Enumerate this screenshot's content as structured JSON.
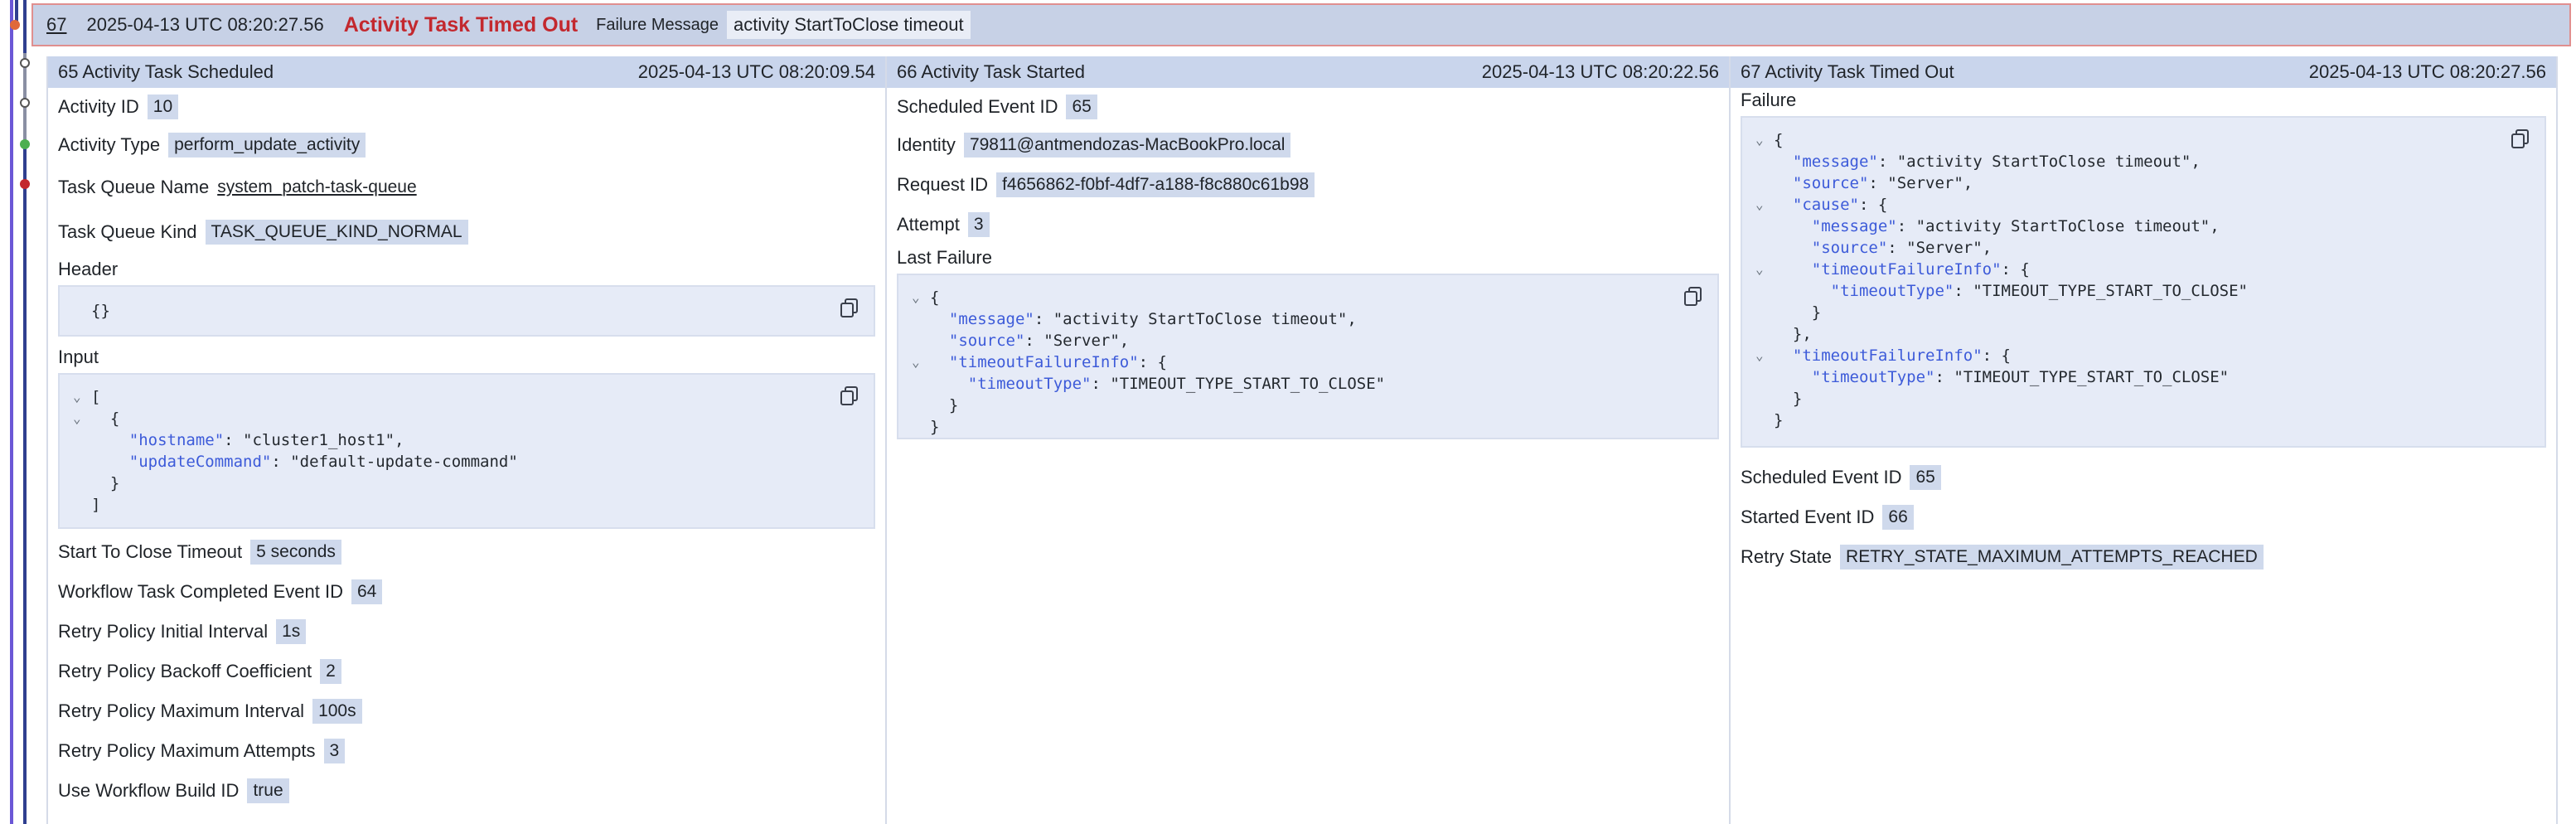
{
  "event": {
    "id": "67",
    "timestamp": "2025-04-13 UTC 08:20:27.56",
    "title": "Activity Task Timed Out",
    "failure_message_label": "Failure Message",
    "failure_message_value": "activity StartToClose timeout"
  },
  "col1": {
    "header_title": "65 Activity Task Scheduled",
    "header_time": "2025-04-13 UTC 08:20:09.54",
    "activity_id_label": "Activity ID",
    "activity_id": "10",
    "activity_type_label": "Activity Type",
    "activity_type": "perform_update_activity",
    "task_queue_name_label": "Task Queue Name",
    "task_queue_name": "system_patch-task-queue",
    "task_queue_kind_label": "Task Queue Kind",
    "task_queue_kind": "TASK_QUEUE_KIND_NORMAL",
    "header_label": "Header",
    "header_json": "{}",
    "input_label": "Input",
    "input_json": {
      "line1": "[",
      "line2": "  {",
      "k_hostname": "\"hostname\"",
      "v_hostname": ": \"cluster1_host1\",",
      "k_update": "\"updateCommand\"",
      "v_update": ": \"default-update-command\"",
      "line5": "  }",
      "line6": "]"
    },
    "start_to_close_label": "Start To Close Timeout",
    "start_to_close": "5 seconds",
    "wf_task_completed_label": "Workflow Task Completed Event ID",
    "wf_task_completed": "64",
    "retry_initial_label": "Retry Policy Initial Interval",
    "retry_initial": "1s",
    "retry_backoff_label": "Retry Policy Backoff Coefficient",
    "retry_backoff": "2",
    "retry_max_interval_label": "Retry Policy Maximum Interval",
    "retry_max_interval": "100s",
    "retry_max_attempts_label": "Retry Policy Maximum Attempts",
    "retry_max_attempts": "3",
    "use_build_id_label": "Use Workflow Build ID",
    "use_build_id": "true"
  },
  "col2": {
    "header_title": "66 Activity Task Started",
    "header_time": "2025-04-13 UTC 08:20:22.56",
    "scheduled_event_id_label": "Scheduled Event ID",
    "scheduled_event_id": "65",
    "identity_label": "Identity",
    "identity": "79811@antmendozas-MacBookPro.local",
    "request_id_label": "Request ID",
    "request_id": "f4656862-f0bf-4df7-a188-f8c880c61b98",
    "attempt_label": "Attempt",
    "attempt": "3",
    "last_failure_label": "Last Failure",
    "json": {
      "open": "{",
      "k_message": "\"message\"",
      "v_message": ": \"activity StartToClose timeout\",",
      "k_source": "\"source\"",
      "v_source": ": \"Server\",",
      "k_tfi": "\"timeoutFailureInfo\"",
      "v_tfi": ": {",
      "k_ttype": "\"timeoutType\"",
      "v_ttype": ": \"TIMEOUT_TYPE_START_TO_CLOSE\"",
      "close_inner": "}",
      "close": "}"
    }
  },
  "col3": {
    "header_title": "67 Activity Task Timed Out",
    "header_time": "2025-04-13 UTC 08:20:27.56",
    "failure_label": "Failure",
    "json": {
      "open": "{",
      "k_message": "\"message\"",
      "v_message": ": \"activity StartToClose timeout\",",
      "k_source": "\"source\"",
      "v_source": ": \"Server\",",
      "k_cause": "\"cause\"",
      "v_cause": ": {",
      "k_message2": "\"message\"",
      "v_message2": ": \"activity StartToClose timeout\",",
      "k_source2": "\"source\"",
      "v_source2": ": \"Server\",",
      "k_tfi2": "\"timeoutFailureInfo\"",
      "v_tfi2": ": {",
      "k_ttype2": "\"timeoutType\"",
      "v_ttype2": ": \"TIMEOUT_TYPE_START_TO_CLOSE\"",
      "close_tfi2": "}",
      "close_cause": "},",
      "k_tfi": "\"timeoutFailureInfo\"",
      "v_tfi": ": {",
      "k_ttype": "\"timeoutType\"",
      "v_ttype": ": \"TIMEOUT_TYPE_START_TO_CLOSE\"",
      "close_tfi": "}",
      "close": "}"
    },
    "scheduled_event_id_label": "Scheduled Event ID",
    "scheduled_event_id": "65",
    "started_event_id_label": "Started Event ID",
    "started_event_id": "66",
    "retry_state_label": "Retry State",
    "retry_state": "RETRY_STATE_MAXIMUM_ATTEMPTS_REACHED"
  },
  "colors": {
    "header_bg": "#c7d1e6",
    "header_border": "#e08f8f",
    "title_red": "#c3282e",
    "chip_bg": "#cfd9ec",
    "json_key": "#3d5bd9",
    "rail_blue": "#2f3f8f",
    "rail_red": "#c3282e",
    "rail_green": "#4caf50"
  },
  "icons": {
    "copy": "copy-icon",
    "collapse": "chevron-down-icon"
  }
}
